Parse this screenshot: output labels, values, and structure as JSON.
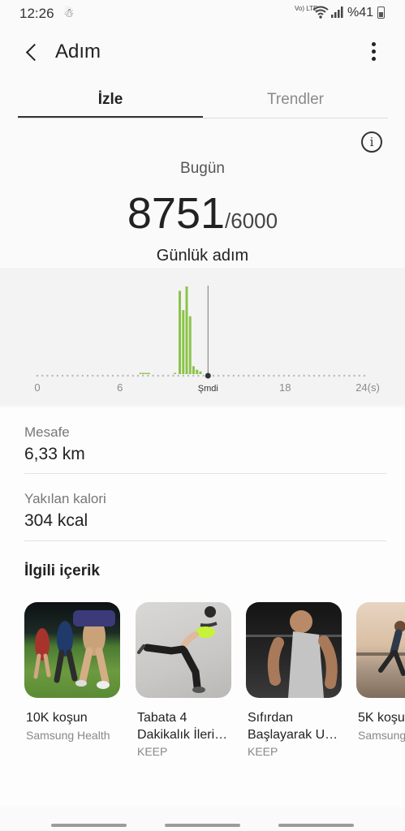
{
  "status_bar": {
    "time": "12:26",
    "volte_label": "Vo) LTE",
    "battery_text": "%41"
  },
  "header": {
    "title": "Adım"
  },
  "tabs": [
    {
      "label": "İzle",
      "active": true
    },
    {
      "label": "Trendler",
      "active": false
    }
  ],
  "summary": {
    "day_label": "Bugün",
    "steps_current": "8751",
    "steps_goal": "/6000",
    "caption": "Günlük adım"
  },
  "chart_data": {
    "type": "bar",
    "x_unit": "hours",
    "xlim": [
      0,
      24
    ],
    "x_ticks": [
      {
        "value": 0,
        "label": "0"
      },
      {
        "value": 6,
        "label": "6"
      },
      {
        "value": 12.4,
        "label": "Şmdi"
      },
      {
        "value": 18,
        "label": "18"
      },
      {
        "value": 24,
        "label": "24(s)"
      }
    ],
    "now_hour": 12.4,
    "bars": [
      {
        "hour": 7.5,
        "value": 0.01
      },
      {
        "hour": 7.7,
        "value": 0.01
      },
      {
        "hour": 7.9,
        "value": 0.01
      },
      {
        "hour": 8.1,
        "value": 0.01
      },
      {
        "hour": 10.0,
        "value": 0.01
      },
      {
        "hour": 10.35,
        "value": 0.95
      },
      {
        "hour": 10.6,
        "value": 0.73
      },
      {
        "hour": 10.85,
        "value": 1.0
      },
      {
        "hour": 11.1,
        "value": 0.66
      },
      {
        "hour": 11.35,
        "value": 0.09
      },
      {
        "hour": 11.6,
        "value": 0.05
      },
      {
        "hour": 11.85,
        "value": 0.03
      }
    ],
    "colors": {
      "bar": "#8bc34a",
      "axis": "#b8b8b8",
      "now_marker": "#333333"
    }
  },
  "metrics": [
    {
      "label": "Mesafe",
      "value": "6,33 km"
    },
    {
      "label": "Yakılan kalori",
      "value": "304 kcal"
    }
  ],
  "related": {
    "title": "İlgili içerik",
    "items": [
      {
        "title": "10K koşun",
        "subtitle": "Samsung Health"
      },
      {
        "title": "Tabata 4 Dakikalık İleri…",
        "subtitle": "KEEP"
      },
      {
        "title": "Sıfırdan Başlayarak U…",
        "subtitle": "KEEP"
      },
      {
        "title": "5K koşu",
        "subtitle": "Samsung"
      }
    ]
  }
}
